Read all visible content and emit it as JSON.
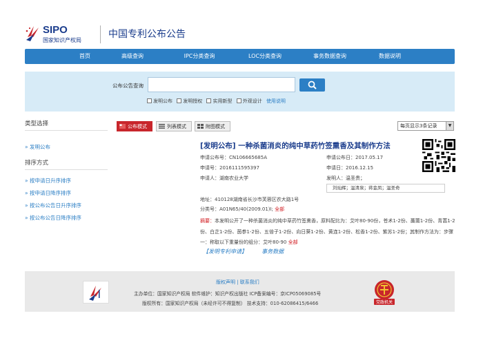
{
  "header": {
    "logo_text": "SIPO",
    "logo_subtitle": "国家知识产权局",
    "site_title": "中国专利公布公告"
  },
  "nav": [
    {
      "label": "首页"
    },
    {
      "label": "高级查询"
    },
    {
      "label": "IPC分类查询"
    },
    {
      "label": "LOC分类查询"
    },
    {
      "label": "事务数据查询"
    },
    {
      "label": "数据说明"
    }
  ],
  "search": {
    "label": "公布公告查询",
    "value": "",
    "filters": [
      "发明公布",
      "发明授权",
      "实用新型",
      "外观设计"
    ],
    "help_link": "使用说明"
  },
  "sidebar": {
    "type_heading": "类型选择",
    "type_items": [
      "» 发明公布"
    ],
    "sort_heading": "排序方式",
    "sort_items": [
      "» 按申请日升序排序",
      "» 按申请日降序排序",
      "» 按公布公告日升序排序",
      "» 按公布公告日降序排序"
    ]
  },
  "view_tabs": [
    "公布模式",
    "列表模式",
    "附图模式"
  ],
  "sort_select": "每页显示3条记录",
  "record": {
    "title": "[发明公布] 一种杀菌消炎的纯中草药竹签熏香及其制作方法",
    "pub_no": "申请公布号：CN106665685A",
    "pub_date": "申请公布日：2017.05.17",
    "app_no": "申请号：2016111595397",
    "app_date": "申请日：2016.12.15",
    "applicant": "申请人：湖南农业大学",
    "inventor_label": "发明人：温圣贵；",
    "inventors": "刘灿辉；温清泉；蒋金凤；温圣奇",
    "address": "地址：410128湖南省长沙市芙蓉区农大路1号",
    "class_no": "分类号：A01N65/40(2009.01)I;",
    "class_all": "全部",
    "abstract_label": "摘要：",
    "abstract_text": "本发明公开了一种杀菌消炎的纯中草药竹签熏香，原料配比为：艾叶80-90份，苍术1-2份、藁薷1-2份、青蒿1-2份、白芷1-2份、茵参1-2份、五倍子1-2份、向日葵1-2份、黄连1-2份、松香1-2份、紫苏1-2份；其制作方法为：步骤一：称取以下重量份的组分：艾叶80-90",
    "abstract_all": "全部",
    "link_publication": "【发明专利申请】",
    "link_affairs": "事务数据"
  },
  "footer": {
    "links": "版权声明 | 联系我们",
    "line1": "主办单位：国家知识产权局   软件维护：知识产权出版社   ICP备案编号：京ICP05069085号",
    "line2": "版权所有：国家知识产权局（未经许可不得复制）   技术支持：010-62086415/6466",
    "badge_text": "党政机关"
  },
  "colors": {
    "brand_blue": "#2c7fc5",
    "title_blue": "#1a3c8c",
    "accent_red": "#c8262c"
  }
}
